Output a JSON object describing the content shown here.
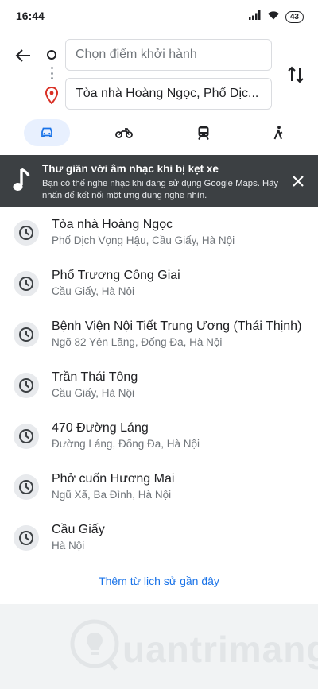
{
  "status_bar": {
    "time": "16:44",
    "battery": "43"
  },
  "directions": {
    "origin_placeholder": "Chọn điểm khởi hành",
    "destination_value": "Tòa nhà Hoàng Ngọc, Phố Dịch Vọng Hậu"
  },
  "modes": [
    {
      "id": "car",
      "icon": "car-icon",
      "active": true
    },
    {
      "id": "motorbike",
      "icon": "motorbike-icon",
      "active": false
    },
    {
      "id": "transit",
      "icon": "train-icon",
      "active": false
    },
    {
      "id": "walk",
      "icon": "walk-icon",
      "active": false
    }
  ],
  "banner": {
    "title": "Thư giãn với âm nhạc khi bị kẹt xe",
    "body": "Bạn có thể nghe nhạc khi đang sử dụng Google Maps. Hãy nhấn để kết nối một ứng dụng nghe nhìn."
  },
  "history": [
    {
      "title": "Tòa nhà Hoàng Ngọc",
      "subtitle": "Phố Dịch Vọng Hậu, Cầu Giấy, Hà Nội"
    },
    {
      "title": "Phố Trương Công Giai",
      "subtitle": "Cầu Giấy, Hà Nội"
    },
    {
      "title": "Bệnh Viện Nội Tiết Trung Ương (Thái Thịnh)",
      "subtitle": "Ngõ 82 Yên Lãng, Đống Đa, Hà Nội"
    },
    {
      "title": "Trần Thái Tông",
      "subtitle": "Cầu Giấy, Hà Nội"
    },
    {
      "title": "470 Đường Láng",
      "subtitle": "Đường Láng, Đống Đa, Hà Nội"
    },
    {
      "title": "Phở cuốn Hương Mai",
      "subtitle": "Ngũ Xã, Ba Đình, Hà Nội"
    },
    {
      "title": "Cầu Giấy",
      "subtitle": "Hà Nội"
    }
  ],
  "more_history_label": "Thêm từ lịch sử gần đây",
  "watermark": "uantrimang",
  "colors": {
    "accent": "#1a73e8",
    "banner_bg": "#3c4043",
    "destination_pin": "#d93025"
  }
}
